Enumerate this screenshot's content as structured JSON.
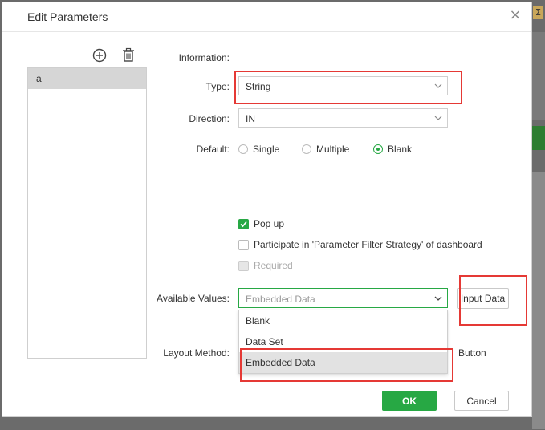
{
  "dialog": {
    "title": "Edit Parameters",
    "close_icon": "close-icon"
  },
  "toolbar": {
    "add_icon": "plus-circle-icon",
    "delete_icon": "trash-icon"
  },
  "parameters": {
    "items": [
      {
        "label": "a",
        "selected": true
      }
    ]
  },
  "form": {
    "information_label": "Information:",
    "type_label": "Type:",
    "type_value": "String",
    "direction_label": "Direction:",
    "direction_value": "IN",
    "default_label": "Default:",
    "default_options": [
      {
        "label": "Single",
        "checked": false
      },
      {
        "label": "Multiple",
        "checked": false
      },
      {
        "label": "Blank",
        "checked": true
      }
    ],
    "popup_label": "Pop up",
    "popup_checked": true,
    "participate_label": "Participate in 'Parameter Filter Strategy' of dashboard",
    "participate_checked": false,
    "required_label": "Required",
    "required_disabled": true,
    "available_values_label": "Available Values:",
    "available_values_value": "Embedded Data",
    "input_data_label": "Input Data",
    "layout_method_label": "Layout Method:",
    "layout_method_fragment": "Button"
  },
  "available_values_dropdown": {
    "options": [
      {
        "label": "Blank",
        "selected": false
      },
      {
        "label": "Data Set",
        "selected": false
      },
      {
        "label": "Embedded Data",
        "selected": true
      }
    ]
  },
  "footer": {
    "ok_label": "OK",
    "cancel_label": "Cancel"
  },
  "colors": {
    "accent": "#27a844",
    "highlight": "#e53935",
    "selected_item": "#d6d6d6"
  }
}
